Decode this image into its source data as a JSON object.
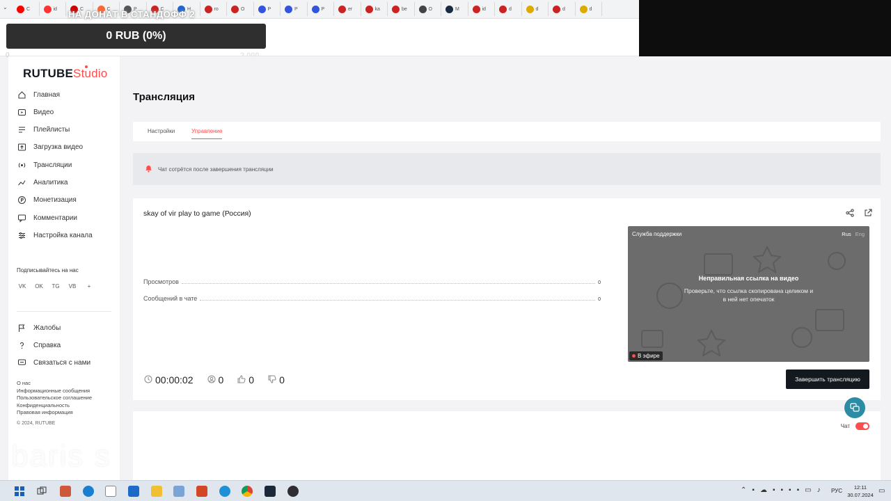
{
  "browser": {
    "tabs": [
      {
        "fav": "#ff0000",
        "label": "C"
      },
      {
        "fav": "#ff3333",
        "label": "id"
      },
      {
        "fav": "#cc0000",
        "label": "C"
      },
      {
        "fav": "#ff6633",
        "label": "C"
      },
      {
        "fav": "#555555",
        "label": "P"
      },
      {
        "fav": "#cc2222",
        "label": "C"
      },
      {
        "fav": "#2266cc",
        "label": "H"
      },
      {
        "fav": "#cc2222",
        "label": "ro"
      },
      {
        "fav": "#cc2222",
        "label": "O"
      },
      {
        "fav": "#3355dd",
        "label": "P"
      },
      {
        "fav": "#3355dd",
        "label": "P"
      },
      {
        "fav": "#3355dd",
        "label": "P"
      },
      {
        "fav": "#cc2222",
        "label": "er"
      },
      {
        "fav": "#cc2222",
        "label": "ka"
      },
      {
        "fav": "#cc2222",
        "label": "be"
      },
      {
        "fav": "#444444",
        "label": "O"
      },
      {
        "fav": "#1a2a40",
        "label": "M"
      },
      {
        "fav": "#cc2222",
        "label": "id"
      },
      {
        "fav": "#cc2222",
        "label": "d"
      },
      {
        "fav": "#ddaa00",
        "label": "d"
      },
      {
        "fav": "#cc2222",
        "label": "d"
      },
      {
        "fav": "#ddaa00",
        "label": "d"
      }
    ]
  },
  "donation": {
    "title": "НА ДОНАТ В СТАНДОФФ 2",
    "amount": "0 RUB (0%)",
    "progress": 0,
    "min": "0",
    "max": "2 000"
  },
  "sidebar": {
    "logo_main": "RUTUBE",
    "logo_studio": "Studio",
    "nav": [
      {
        "label": "Главная",
        "icon": "home-icon"
      },
      {
        "label": "Видео",
        "icon": "video-icon"
      },
      {
        "label": "Плейлисты",
        "icon": "playlist-icon"
      },
      {
        "label": "Загрузка видео",
        "icon": "upload-icon"
      },
      {
        "label": "Трансляции",
        "icon": "broadcast-icon"
      },
      {
        "label": "Аналитика",
        "icon": "analytics-icon"
      },
      {
        "label": "Монетизация",
        "icon": "monetization-icon"
      },
      {
        "label": "Комментарии",
        "icon": "comments-icon"
      },
      {
        "label": "Настройка канала",
        "icon": "channel-settings-icon"
      }
    ],
    "follow_label": "Подписывайтесь на нас",
    "socials": [
      "VK",
      "OK",
      "TG",
      "VB",
      "+"
    ],
    "support_nav": [
      {
        "label": "Жалобы",
        "icon": "flag-icon"
      },
      {
        "label": "Справка",
        "icon": "help-icon"
      },
      {
        "label": "Связаться с нами",
        "icon": "chat-icon"
      }
    ],
    "footer_links": [
      "О нас",
      "Информационные сообщения",
      "Пользовательское соглашение",
      "Конфиденциальность",
      "Правовая информация"
    ],
    "copyright": "© 2024, RUTUBE"
  },
  "main": {
    "title": "Трансляция",
    "tabs": [
      {
        "label": "Настройки",
        "active": false
      },
      {
        "label": "Управление",
        "active": true
      }
    ],
    "notice": "Чат сотрётся после завершения трансляции",
    "stream": {
      "title": "skay of vir play to game (Россия)",
      "stats": [
        {
          "label": "Просмотров",
          "value": "0"
        },
        {
          "label": "Сообщений в чате",
          "value": "0"
        }
      ],
      "timer": "00:00:02",
      "viewers": "0",
      "likes": "0",
      "dislikes": "0",
      "end_button": "Завершить трансляцию"
    },
    "preview": {
      "support": "Служба поддержки",
      "lang_active": "Rus",
      "lang_other": "Eng",
      "error_title": "Неправильная ссылка на видео",
      "error_text": "Проверьте, что ссылка скопирована целиком и в ней нет опечаток",
      "live_label": "В эфире"
    },
    "chat_label": "Чат",
    "chat_enabled": true
  },
  "watermark": "baris s",
  "taskbar": {
    "lang": "РУС",
    "time": "12:11",
    "date": "30.07.2024"
  },
  "colors": {
    "accent": "#ff4c4c",
    "dark": "#14191f",
    "fab": "#2b8ca3"
  }
}
